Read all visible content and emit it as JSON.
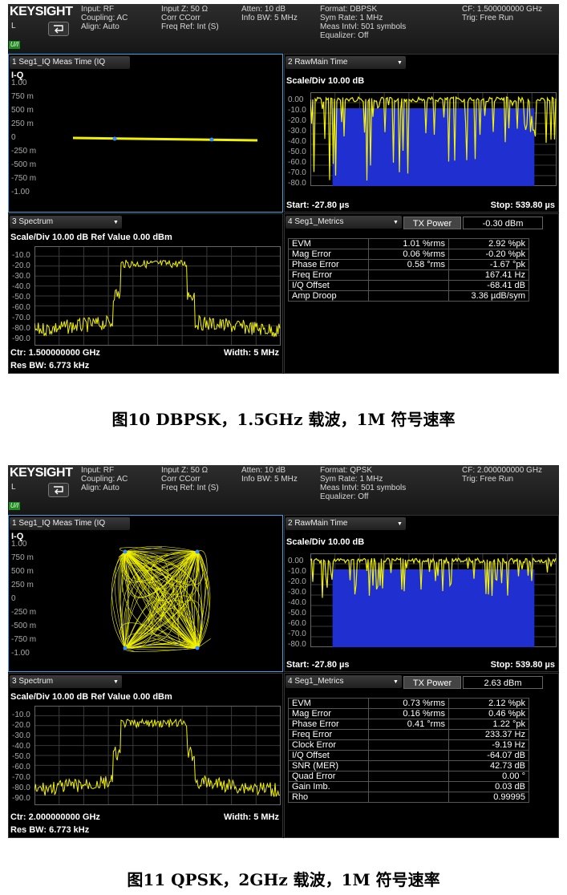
{
  "screens": [
    {
      "brand": "KEYSIGHT",
      "mode": "L",
      "indicator": "U/I",
      "hdr": [
        [
          "Input: RF",
          "Coupling: AC",
          "Align: Auto"
        ],
        [
          "Input Z: 50 Ω",
          "Corr CCorr",
          "Freq Ref: Int (S)"
        ],
        [
          "Atten: 10 dB",
          "Info BW: 5 MHz"
        ],
        [
          "Format: DBPSK",
          "Sym Rate: 1 MHz",
          "Meas Intvl: 501 symbols",
          "Equalizer: Off"
        ],
        [
          "CF: 1.500000000 GHz",
          "Trig: Free Run"
        ]
      ],
      "w1": {
        "title": "1 Seg1_IQ Meas Time (IQ",
        "ylabel": "I-Q",
        "ticks": [
          "1.00",
          "750 m",
          "500 m",
          "250 m",
          "0",
          "-250 m",
          "-500 m",
          "-750 m",
          "-1.00"
        ]
      },
      "w2": {
        "title": "2 RawMain Time",
        "scale": "Scale/Div 10.00 dB",
        "ticks": [
          "0.00",
          "-10.0",
          "-20.0",
          "-30.0",
          "-40.0",
          "-50.0",
          "-60.0",
          "-70.0",
          "-80.0"
        ],
        "start": "Start: -27.80 µs",
        "stop": "Stop: 539.80 µs"
      },
      "w3": {
        "title": "3 Spectrum",
        "scale": "Scale/Div 10.00 dB Ref Value 0.00 dBm",
        "ticks": [
          "-10.0",
          "-20.0",
          "-30.0",
          "-40.0",
          "-50.0",
          "-60.0",
          "-70.0",
          "-80.0",
          "-90.0"
        ],
        "ctr": "Ctr: 1.500000000 GHz",
        "width": "Width: 5 MHz",
        "rbw": "Res BW: 6.773 kHz"
      },
      "w4": {
        "title": "4 Seg1_Metrics",
        "tx_label": "TX Power",
        "tx_value": "-0.30 dBm",
        "rows": [
          [
            "EVM",
            "1.01 %rms",
            "2.92 %pk"
          ],
          [
            "Mag Error",
            "0.06 %rms",
            "-0.20 %pk"
          ],
          [
            "Phase Error",
            "0.58 °rms",
            "-1.67 °pk"
          ],
          [
            "Freq Error",
            "",
            "167.41 Hz"
          ],
          [
            "I/Q Offset",
            "",
            "-68.41 dB"
          ],
          [
            "Amp Droop",
            "",
            "3.36 µdB/sym"
          ]
        ]
      },
      "caption": "图10  DBPSK，1.5GHz 载波，1M 符号速率"
    },
    {
      "brand": "KEYSIGHT",
      "mode": "L",
      "indicator": "U/I",
      "hdr": [
        [
          "Input: RF",
          "Coupling: AC",
          "Align: Auto"
        ],
        [
          "Input Z: 50 Ω",
          "Corr CCorr",
          "Freq Ref: Int (S)"
        ],
        [
          "Atten: 10 dB",
          "Info BW: 5 MHz"
        ],
        [
          "Format: QPSK",
          "Sym Rate: 1 MHz",
          "Meas Intvl: 501 symbols",
          "Equalizer: Off"
        ],
        [
          "CF: 2.000000000 GHz",
          "Trig: Free Run"
        ]
      ],
      "w1": {
        "title": "1 Seg1_IQ Meas Time (IQ",
        "ylabel": "I-Q",
        "ticks": [
          "1.00",
          "750 m",
          "500 m",
          "250 m",
          "0",
          "-250 m",
          "-500 m",
          "-750 m",
          "-1.00"
        ]
      },
      "w2": {
        "title": "2 RawMain Time",
        "scale": "Scale/Div 10.00 dB",
        "ticks": [
          "0.00",
          "-10.0",
          "-20.0",
          "-30.0",
          "-40.0",
          "-50.0",
          "-60.0",
          "-70.0",
          "-80.0"
        ],
        "start": "Start: -27.80 µs",
        "stop": "Stop: 539.80 µs"
      },
      "w3": {
        "title": "3 Spectrum",
        "scale": "Scale/Div 10.00 dB Ref Value 0.00 dBm",
        "ticks": [
          "-10.0",
          "-20.0",
          "-30.0",
          "-40.0",
          "-50.0",
          "-60.0",
          "-70.0",
          "-80.0",
          "-90.0"
        ],
        "ctr": "Ctr: 2.000000000 GHz",
        "width": "Width: 5 MHz",
        "rbw": "Res BW: 6.773 kHz"
      },
      "w4": {
        "title": "4 Seg1_Metrics",
        "tx_label": "TX Power",
        "tx_value": "2.63 dBm",
        "rows": [
          [
            "EVM",
            "0.73 %rms",
            "2.12 %pk"
          ],
          [
            "Mag Error",
            "0.16 %rms",
            "0.46 %pk"
          ],
          [
            "Phase Error",
            "0.41 °rms",
            "1.22 °pk"
          ],
          [
            "Freq Error",
            "",
            "233.37 Hz"
          ],
          [
            "Clock Error",
            "",
            "-9.19 Hz"
          ],
          [
            "I/Q Offset",
            "",
            "-64.07 dB"
          ],
          [
            "SNR (MER)",
            "",
            "42.73 dB"
          ],
          [
            "Quad Error",
            "",
            "0.00 °"
          ],
          [
            "Gain Imb.",
            "",
            "0.03 dB"
          ],
          [
            "Rho",
            "",
            "0.99995"
          ]
        ]
      },
      "caption": "图11  QPSK，2GHz 载波，1M 符号速率"
    }
  ],
  "colors": {
    "trace": "#f2f200",
    "fill": "#1f2fd0",
    "accent": "#3aa6e6",
    "grid": "#3a3a3a"
  }
}
